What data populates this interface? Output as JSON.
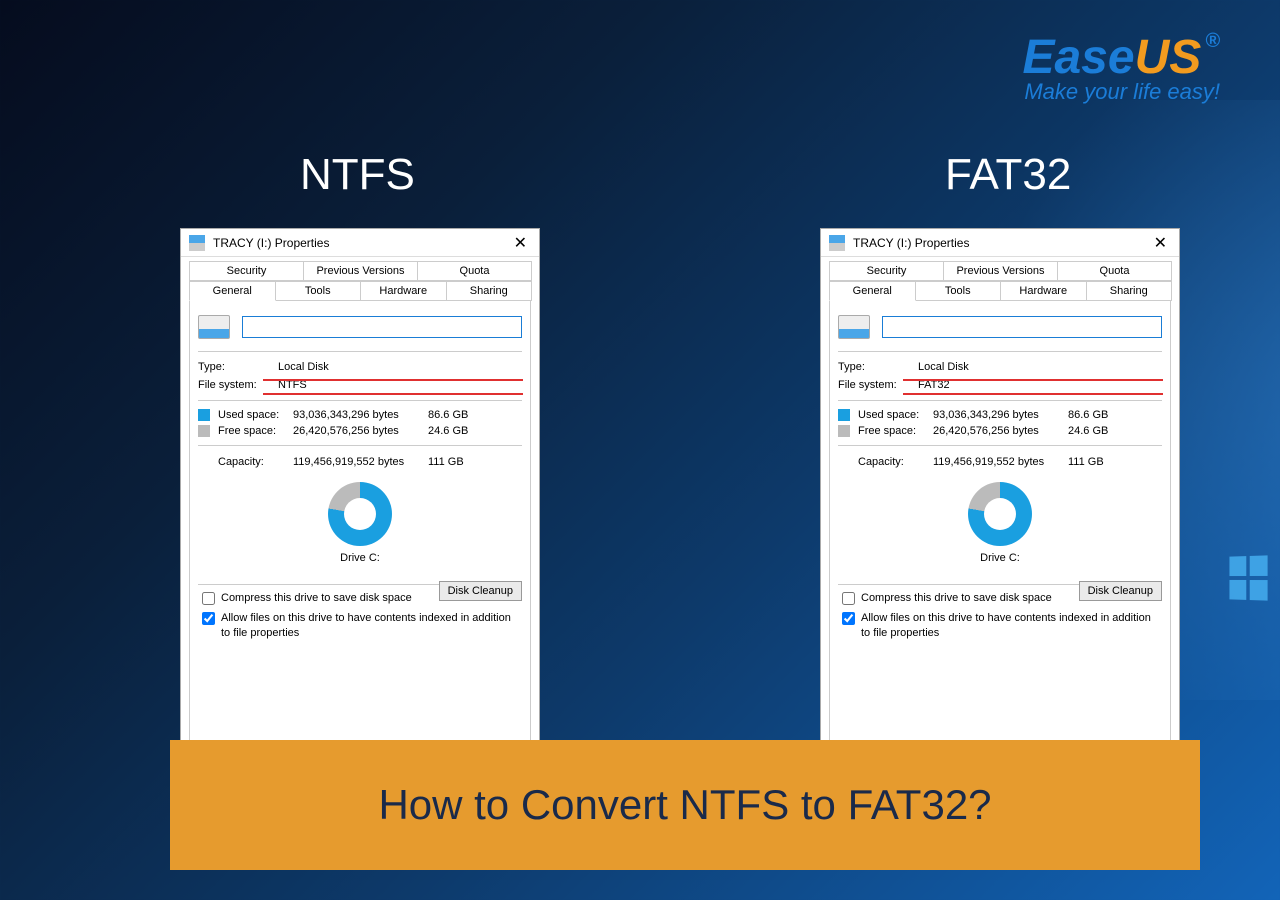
{
  "logo": {
    "ease": "Ease",
    "us": "US",
    "reg": "®",
    "tagline": "Make your life easy!"
  },
  "headings": {
    "left": "NTFS",
    "right": "FAT32"
  },
  "banner": {
    "text": "How to Convert NTFS to FAT32?"
  },
  "titlebar": {
    "title": "TRACY (I:) Properties",
    "close": "✕"
  },
  "tabs": {
    "row1": [
      "Security",
      "Previous Versions",
      "Quota"
    ],
    "row2": [
      "General",
      "Tools",
      "Hardware",
      "Sharing"
    ],
    "active": "General"
  },
  "general": {
    "name_value": "",
    "type_label": "Type:",
    "type_value": "Local Disk",
    "fs_label": "File system:",
    "used_label": "Used space:",
    "used_bytes": "93,036,343,296 bytes",
    "used_human": "86.6 GB",
    "free_label": "Free space:",
    "free_bytes": "26,420,576,256 bytes",
    "free_human": "24.6 GB",
    "capacity_label": "Capacity:",
    "capacity_bytes": "119,456,919,552 bytes",
    "capacity_human": "111 GB",
    "drive_label": "Drive C:",
    "cleanup": "Disk Cleanup",
    "compress": "Compress this drive to save disk space",
    "index": "Allow files on this drive to have contents indexed in addition to file properties"
  },
  "dialogs": {
    "left_fs": "NTFS",
    "right_fs": "FAT32"
  }
}
